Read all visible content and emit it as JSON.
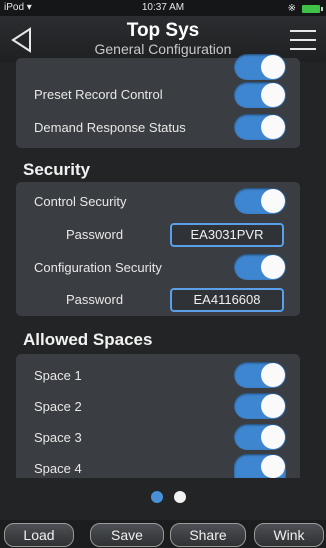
{
  "status": {
    "carrier": "iPod",
    "time": "10:37 AM"
  },
  "header": {
    "title": "Top Sys",
    "subtitle": "General Configuration"
  },
  "spaces_section": {
    "top_rows": [
      "Preset Record Control",
      "Demand Response Status"
    ]
  },
  "security": {
    "title": "Security",
    "control_security_label": "Control Security",
    "password_label": "Password",
    "control_password": "EA3031PVR",
    "config_security_label": "Configuration Security",
    "config_password": "EA4116608"
  },
  "allowed_spaces": {
    "title": "Allowed Spaces",
    "items": [
      "Space 1",
      "Space 2",
      "Space 3",
      "Space 4"
    ]
  },
  "pager": {
    "current": 1,
    "total": 2
  },
  "toolbar": {
    "load": "Load",
    "save": "Save",
    "share": "Share",
    "wink": "Wink"
  },
  "colors": {
    "toggle_on": "#3f86d1",
    "accent_border": "#5aa0e8",
    "page_dot_active": "#4a90d9"
  }
}
